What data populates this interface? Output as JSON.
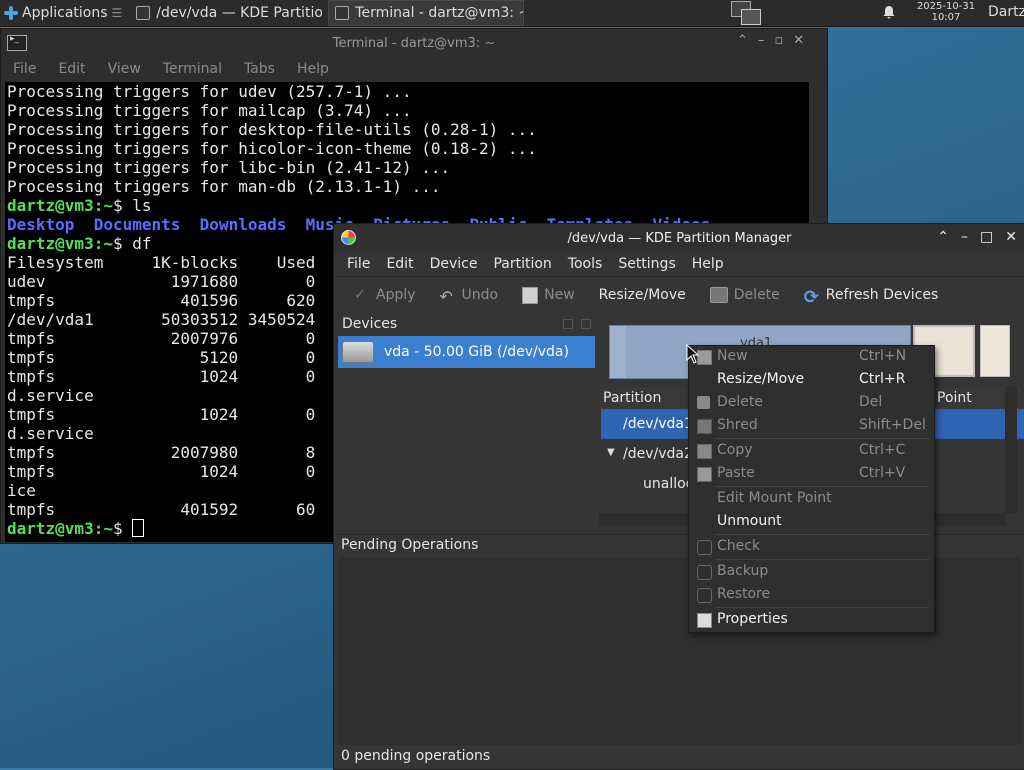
{
  "panel": {
    "applications_label": "Applications",
    "tasks": [
      {
        "label": "/dev/vda — KDE Partitio..."
      },
      {
        "label": "Terminal - dartz@vm3: ~"
      }
    ],
    "date": "2025-10-31",
    "time": "10:07",
    "user": "Dartz"
  },
  "terminal": {
    "title": "Terminal - dartz@vm3: ~",
    "menu": [
      "File",
      "Edit",
      "View",
      "Terminal",
      "Tabs",
      "Help"
    ],
    "lines": [
      "Processing triggers for udev (257.7-1) ...",
      "Processing triggers for mailcap (3.74) ...",
      "Processing triggers for desktop-file-utils (0.28-1) ...",
      "Processing triggers for hicolor-icon-theme (0.18-2) ...",
      "Processing triggers for libc-bin (2.41-12) ...",
      "Processing triggers for man-db (2.13.1-1) ..."
    ],
    "prompt_user": "dartz@vm3",
    "prompt_path": ":~",
    "prompt_sym": "$",
    "cmd1": " ls",
    "ls_dirs": [
      "Desktop",
      "Documents",
      "Downloads",
      "Music",
      "Pictures",
      "Public",
      "Templates",
      "Videos"
    ],
    "cmd2": " df",
    "df_lines": [
      "Filesystem     1K-blocks    Used",
      "udev             1971680       0",
      "tmpfs             401596     620",
      "/dev/vda1       50303512 3450524",
      "tmpfs            2007976       0",
      "tmpfs               5120       0",
      "tmpfs               1024       0",
      "d.service",
      "tmpfs               1024       0",
      "d.service",
      "tmpfs            2007980       8",
      "tmpfs               1024       0",
      "ice",
      "tmpfs             401592      60"
    ]
  },
  "pm": {
    "title": "/dev/vda — KDE Partition Manager",
    "menu": [
      "File",
      "Edit",
      "Device",
      "Partition",
      "Tools",
      "Settings",
      "Help"
    ],
    "toolbar": {
      "apply": "Apply",
      "undo": "Undo",
      "new": "New",
      "resize": "Resize/Move",
      "delete": "Delete",
      "refresh": "Refresh Devices"
    },
    "devices_heading": "Devices",
    "device_item": "vda - 50.00 GiB (/dev/vda)",
    "bar_label": "vda1",
    "table": {
      "col_partition": "Partition",
      "col_mount": "Point",
      "rows": [
        "/dev/vda1",
        "/dev/vda2",
        "unalloc"
      ]
    },
    "pending_heading": "Pending Operations",
    "pending_status": "0 pending operations"
  },
  "context_menu": {
    "items": [
      {
        "label": "New",
        "shortcut": "Ctrl+N",
        "enabled": false
      },
      {
        "label": "Resize/Move",
        "shortcut": "Ctrl+R",
        "enabled": true
      },
      {
        "label": "Delete",
        "shortcut": "Del",
        "enabled": false
      },
      {
        "label": "Shred",
        "shortcut": "Shift+Del",
        "enabled": false
      },
      {
        "label": "Copy",
        "shortcut": "Ctrl+C",
        "enabled": false
      },
      {
        "label": "Paste",
        "shortcut": "Ctrl+V",
        "enabled": false
      },
      {
        "label": "Edit Mount Point",
        "shortcut": "",
        "enabled": false
      },
      {
        "label": "Unmount",
        "shortcut": "",
        "enabled": true
      },
      {
        "label": "Check",
        "shortcut": "",
        "enabled": false
      },
      {
        "label": "Backup",
        "shortcut": "",
        "enabled": false
      },
      {
        "label": "Restore",
        "shortcut": "",
        "enabled": false
      },
      {
        "label": "Properties",
        "shortcut": "",
        "enabled": true
      }
    ]
  },
  "colors": {
    "selection": "#3a7fd0",
    "prompt": "#55e055",
    "directory": "#5a6cff"
  }
}
